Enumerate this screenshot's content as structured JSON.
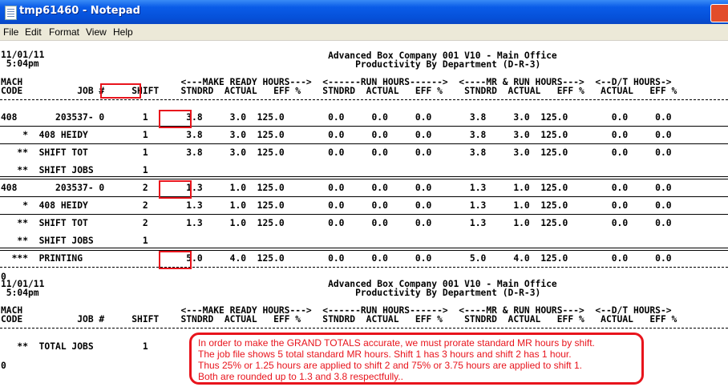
{
  "window": {
    "title": "tmp61460 - Notepad"
  },
  "menu": [
    "File",
    "Edit",
    "Format",
    "View",
    "Help"
  ],
  "report_lines": [
    "11/01/11",
    " 5:04pm",
    "                                                            Advanced Box Company 001 V10 - Main Office",
    "                                                                 Productivity By Department (D-R-3)",
    "MACH                             <---MAKE READY HOURS--->  <------RUN HOURS------>  <----MR & RUN HOURS--->  <--D/T HOURS->",
    "CODE          JOB #     SHIFT    STNDRD  ACTUAL   EFF %    STNDRD  ACTUAL   EFF %    STNDRD  ACTUAL   EFF %   ACTUAL   EFF %",
    "408       203537- 0       1       3.8     3.0  125.0        0.0     0.0     0.0       3.8     3.0  125.0        0.0     0.0",
    "    *  408 HEIDY          1       3.8     3.0  125.0        0.0     0.0     0.0       3.8     3.0  125.0        0.0     0.0",
    "   **  SHIFT TOT          1       3.8     3.0  125.0        0.0     0.0     0.0       3.8     3.0  125.0        0.0     0.0",
    "   **  SHIFT JOBS         1",
    "408       203537- 0       2       1.3     1.0  125.0        0.0     0.0     0.0       1.3     1.0  125.0        0.0     0.0",
    "    *  408 HEIDY          2       1.3     1.0  125.0        0.0     0.0     0.0       1.3     1.0  125.0        0.0     0.0",
    "   **  SHIFT TOT          2       1.3     1.0  125.0        0.0     0.0     0.0       1.3     1.0  125.0        0.0     0.0",
    "   **  SHIFT JOBS         1",
    "  ***  PRINTING                   5.0     4.0  125.0        0.0     0.0     0.0       5.0     4.0  125.0        0.0     0.0",
    "0",
    "11/01/11                                                    Advanced Box Company 001 V10 - Main Office",
    " 5:04pm                                                          Productivity By Department (D-R-3)",
    "MACH                             <---MAKE READY HOURS--->  <------RUN HOURS------>  <----MR & RUN HOURS--->  <--D/T HOURS->",
    "CODE          JOB #     SHIFT    STNDRD  ACTUAL   EFF %    STNDRD  ACTUAL   EFF %    STNDRD  ACTUAL   EFF %   ACTUAL   EFF %",
    "   **  TOTAL JOBS         1",
    "0"
  ],
  "highlights": [
    "SHIFT",
    "3.8",
    "1.3",
    "5.0"
  ],
  "note_lines": [
    "In order to make the GRAND TOTALS accurate, we must prorate standard MR hours by shift.",
    "The job file shows 5 total standard MR hours.  Shift 1 has 3 hours and shift 2 has 1 hour.",
    "Thus 25% or 1.25 hours are applied to shift 2 and 75% or 3.75 hours are applied to shift 1.",
    "Both are rounded up to 1.3 and 3.8 respectfully.."
  ],
  "colors": {
    "titlebar": "#0a5ce8",
    "highlight": "#e8141c",
    "menubar": "#ece9d8"
  }
}
